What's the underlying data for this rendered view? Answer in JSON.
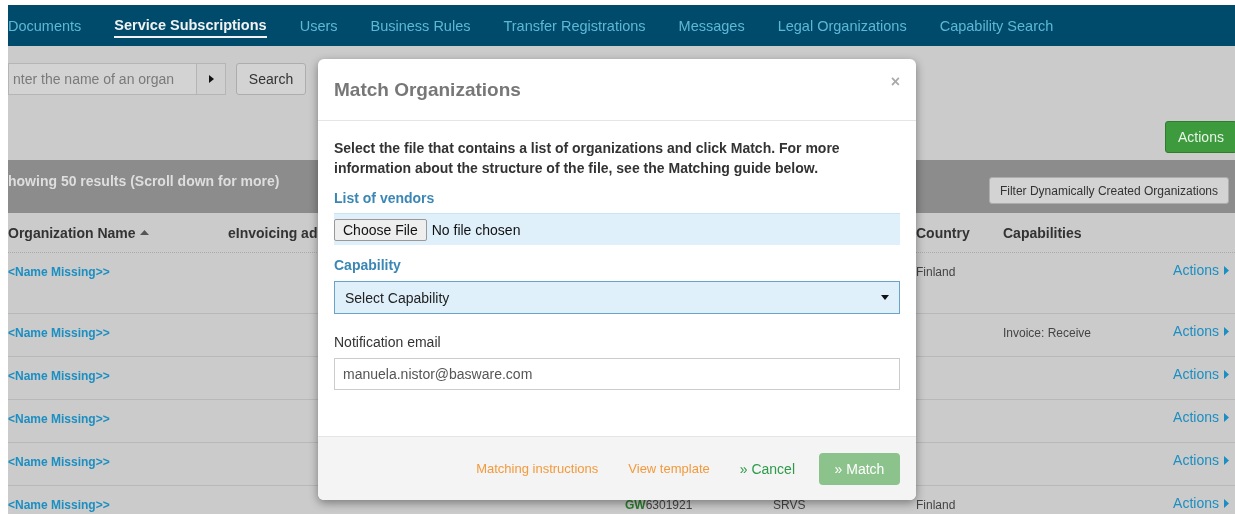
{
  "nav": {
    "items": [
      {
        "label": "Documents",
        "selected": false
      },
      {
        "label": "Service Subscriptions",
        "selected": true
      },
      {
        "label": "Users",
        "selected": false
      },
      {
        "label": "Business Rules",
        "selected": false
      },
      {
        "label": "Transfer Registrations",
        "selected": false
      },
      {
        "label": "Messages",
        "selected": false
      },
      {
        "label": "Legal Organizations",
        "selected": false
      },
      {
        "label": "Capability Search",
        "selected": false
      }
    ]
  },
  "search": {
    "placeholder": "nter the name of an organ",
    "button": "Search"
  },
  "actions_button": "Actions",
  "results": {
    "summary": "howing 50 results (Scroll down for more)",
    "filter_button": "Filter Dynamically Created Organizations"
  },
  "table": {
    "columns": [
      {
        "label": "Organization Name",
        "sorted_ascending": true
      },
      {
        "label": "eInvoicing ad"
      },
      {},
      {},
      {
        "label": "Country"
      },
      {
        "label": "Capabilities"
      }
    ],
    "rows": [
      {
        "name": "<Name Missing>>",
        "country": "Finland",
        "action": "Actions"
      },
      {
        "name": "<Name Missing>>",
        "capabilities": "Invoice: Receive",
        "action": "Actions"
      },
      {
        "name": "<Name Missing>>",
        "action": "Actions"
      },
      {
        "name": "<Name Missing>>",
        "action": "Actions"
      },
      {
        "name": "<Name Missing>>",
        "action": "Actions"
      },
      {
        "name": "<Name Missing>>",
        "column_3": "**GW**6301921",
        "column_4": "SRVS",
        "country": "Finland",
        "action": "Actions"
      }
    ]
  },
  "dialog": {
    "title": "Match Organizations",
    "close": "×",
    "instructions": "Select the file that contains a list of organizations and click Match. For more information about the structure of the file, see the Matching guide below.",
    "vendors_label": "List of vendors",
    "file_button": "Choose File",
    "file_status": "No file chosen",
    "capability_label": "Capability",
    "capability_value": "Select Capability",
    "email_label": "Notification email",
    "email_value": "manuela.nistor@basware.com",
    "links": [
      "Matching instructions",
      "View template"
    ],
    "cancel": "» Cancel",
    "match": {
      "label": "» Match",
      "disabled": true
    }
  }
}
